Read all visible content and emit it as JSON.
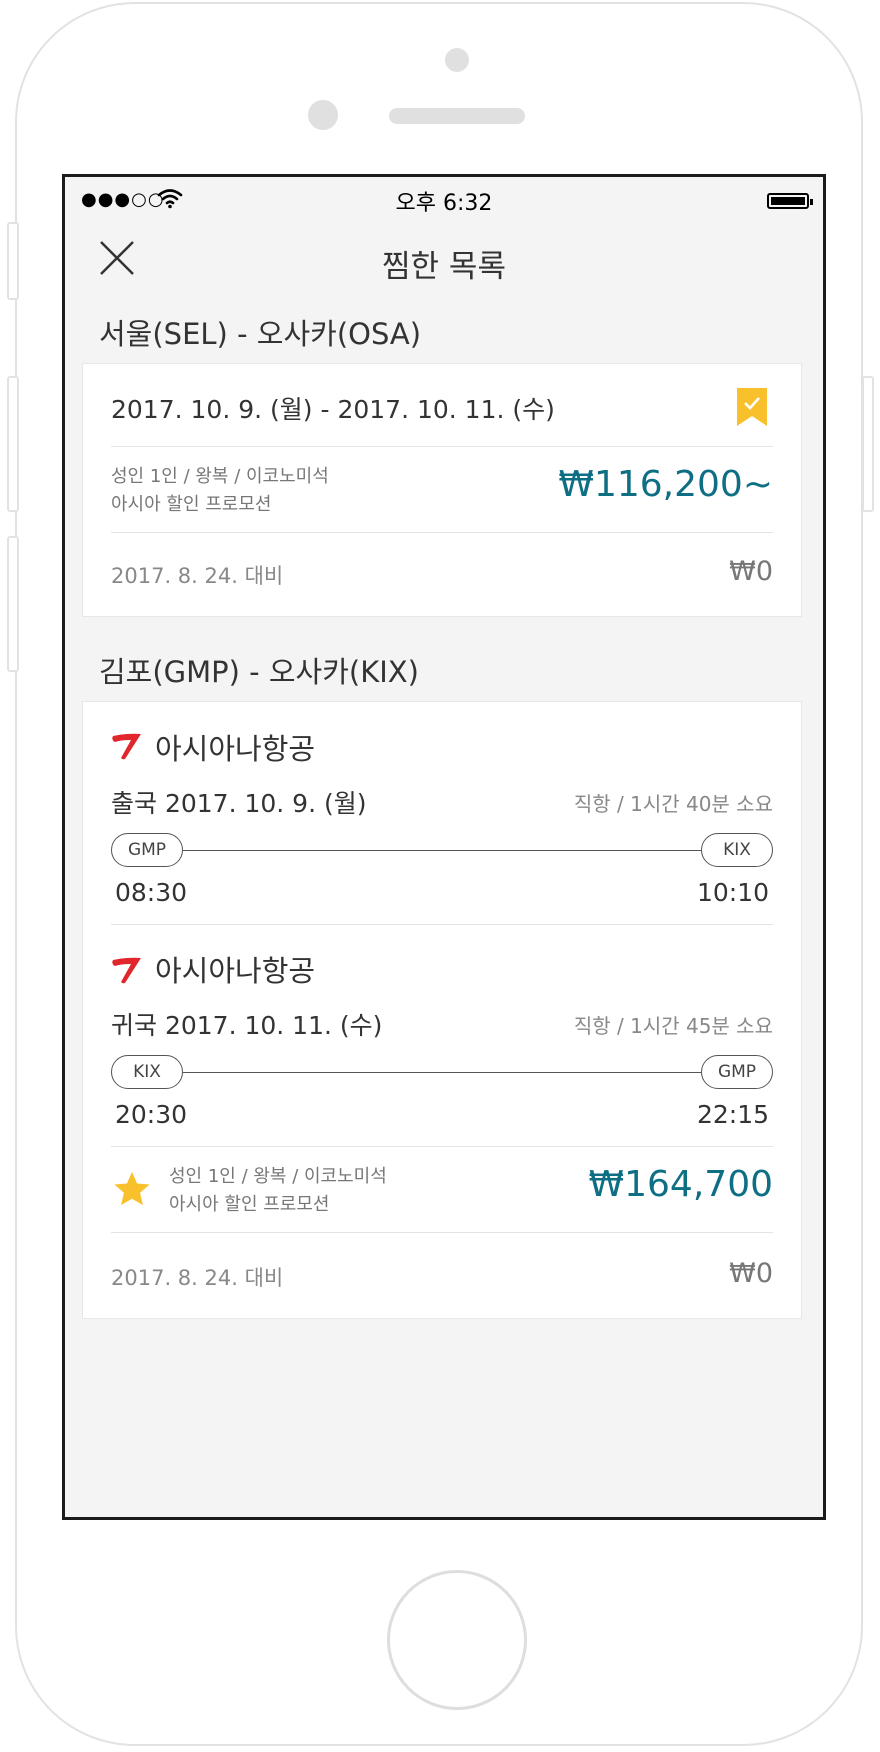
{
  "status_bar": {
    "signal": "●●●○○",
    "time": "오후 6:32"
  },
  "nav": {
    "title": "찜한 목록",
    "close_icon": "close-icon"
  },
  "wishlist": [
    {
      "route_title": "서울(SEL) - 오사카(OSA)",
      "date_range": "2017. 10. 9. (월) - 2017. 10. 11. (수)",
      "bookmark_icon": "bookmark-check-icon",
      "bookmark_color": "#f8c12b",
      "passenger_info": "성인 1인 / 왕복 / 이코노미석",
      "promotion": "아시아 할인 프로모션",
      "price": "₩116,200~",
      "compare_date": "2017. 8. 24. 대비",
      "price_diff": "₩0"
    },
    {
      "route_title": "김포(GMP) - 오사카(KIX)",
      "legs": [
        {
          "airline": "아시아나항공",
          "airline_icon": "asiana-logo-icon",
          "date": "출국 2017. 10. 9. (월)",
          "info": "직항 / 1시간 40분 소요",
          "from": "GMP",
          "to": "KIX",
          "depart_time": "08:30",
          "arrive_time": "10:10"
        },
        {
          "airline": "아시아나항공",
          "airline_icon": "asiana-logo-icon",
          "date": "귀국 2017. 10. 11. (수)",
          "info": "직항 / 1시간 45분 소요",
          "from": "KIX",
          "to": "GMP",
          "depart_time": "20:30",
          "arrive_time": "22:15"
        }
      ],
      "star_icon": "star-icon",
      "star_color": "#f8c12b",
      "passenger_info": "성인 1인 / 왕복 / 이코노미석",
      "promotion": "아시아 할인 프로모션",
      "price": "₩164,700",
      "compare_date": "2017. 8. 24. 대비",
      "price_diff": "₩0"
    }
  ],
  "colors": {
    "price": "#0e6e83",
    "accent_yellow": "#f8c12b",
    "asiana_red": "#e1262d",
    "screen_bg": "#f4f4f4"
  }
}
